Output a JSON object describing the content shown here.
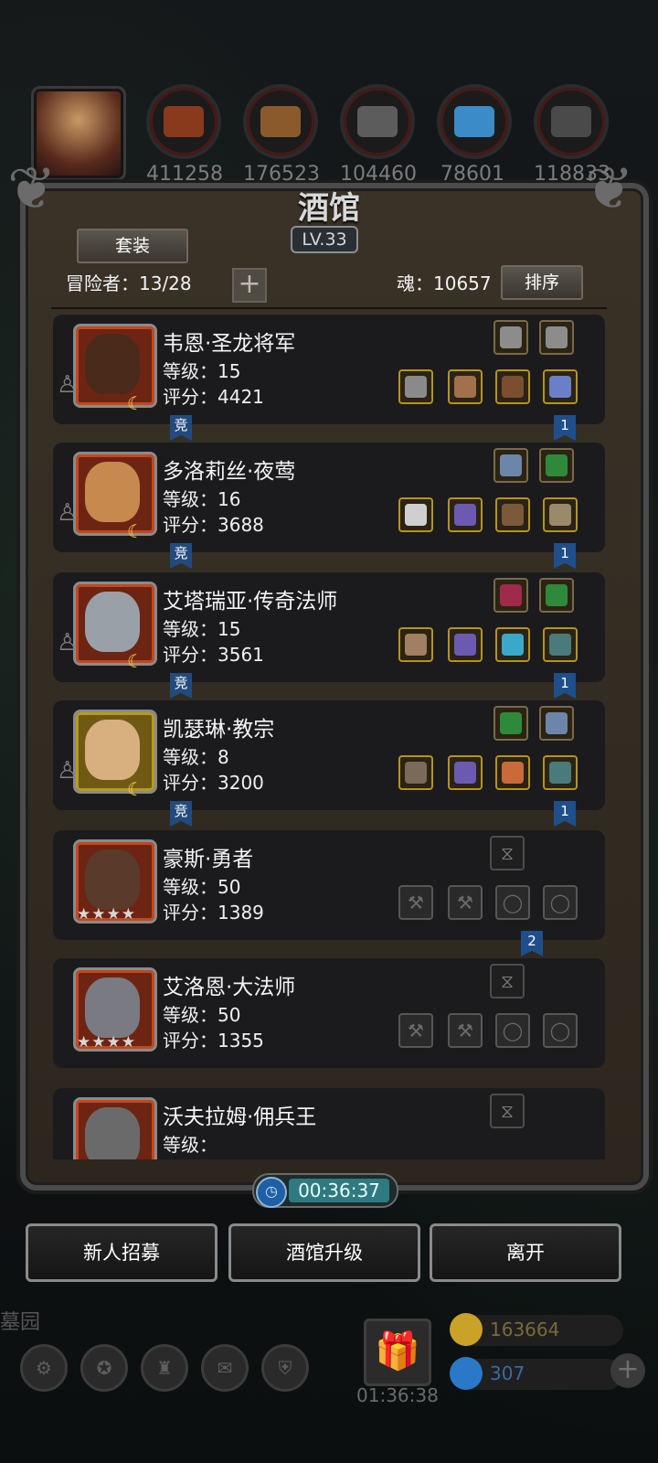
{
  "resources": [
    {
      "name": "meat",
      "value": "411258",
      "color": "#8a3a1c"
    },
    {
      "name": "wood",
      "value": "176523",
      "color": "#8b5a2b"
    },
    {
      "name": "stone",
      "value": "104460",
      "color": "#5c5c5c"
    },
    {
      "name": "crystal",
      "value": "78601",
      "color": "#3a8bc8"
    },
    {
      "name": "iron",
      "value": "118833",
      "color": "#4a4a4a"
    }
  ],
  "tavern": {
    "title": "酒馆",
    "level": "LV.33",
    "set_button": "套装",
    "adventurers_label": "冒险者：13/28",
    "soul_label": "魂：10657",
    "sort_button": "排序"
  },
  "heroes": [
    {
      "name": "韦恩·圣龙将军",
      "level": "等级：15",
      "score": "评分：4421",
      "frame": "red",
      "face": "#4a2a1a",
      "badge": "moon",
      "arena": "竞",
      "tag": "1",
      "top_slots": [
        "#8c8c8c",
        "#8c8c8c"
      ],
      "bottom_slots": [
        "#8a8a8a",
        "#a0714a",
        "#7a4e2e",
        "#6a7fc8"
      ]
    },
    {
      "name": "多洛莉丝·夜莺",
      "level": "等级：16",
      "score": "评分：3688",
      "frame": "red",
      "face": "#c8894f",
      "badge": "moon",
      "arena": "竞",
      "tag": "1",
      "top_slots": [
        "#6b86a8",
        "#2e8a3a"
      ],
      "bottom_slots": [
        "#cfcfcf",
        "#6b5ab0",
        "#7a5a3a",
        "#9a8a6a"
      ]
    },
    {
      "name": "艾塔瑞亚·传奇法师",
      "level": "等级：15",
      "score": "评分：3561",
      "frame": "red",
      "face": "#9aa0a8",
      "badge": "moon",
      "arena": "竞",
      "tag": "1",
      "top_slots": [
        "#a02a4a",
        "#2e8a3a"
      ],
      "bottom_slots": [
        "#a08060",
        "#6b5ab0",
        "#3aa8c8",
        "#4a7a7a"
      ]
    },
    {
      "name": "凯瑟琳·教宗",
      "level": "等级：8",
      "score": "评分：3200",
      "frame": "gold",
      "face": "#d8b080",
      "badge": "moon",
      "arena": "竞",
      "tag": "1",
      "top_slots": [
        "#2e8a3a",
        "#6b86a8"
      ],
      "bottom_slots": [
        "#7a6a5a",
        "#6b5ab0",
        "#c86a3a",
        "#4a7a7a"
      ]
    },
    {
      "name": "豪斯·勇者",
      "level": "等级：50",
      "score": "评分：1389",
      "frame": "red",
      "face": "#5a3a2a",
      "badge": "stars",
      "stars": "★★★★",
      "tag": "2",
      "top_slots": [
        "empty"
      ],
      "bottom_slots": [
        "dim",
        "dim",
        "dim",
        "dim"
      ]
    },
    {
      "name": "艾洛恩·大法师",
      "level": "等级：50",
      "score": "评分：1355",
      "frame": "red",
      "face": "#7a7a82",
      "badge": "stars",
      "stars": "★★★★",
      "top_slots": [
        "empty"
      ],
      "bottom_slots": [
        "dim",
        "dim",
        "dim",
        "dim"
      ]
    },
    {
      "name": "沃夫拉姆·佣兵王",
      "level": "等级：",
      "score": "",
      "frame": "red",
      "face": "#6a6a6a",
      "badge": "none",
      "top_slots": [
        "empty"
      ],
      "bottom_slots": []
    }
  ],
  "timer": "00:36:37",
  "buttons": {
    "recruit": "新人招募",
    "upgrade": "酒馆升级",
    "leave": "离开"
  },
  "dock": {
    "garden": "墓园",
    "gift_timer": "01:36:38"
  },
  "currency": {
    "gold": "163664",
    "gold_color": "#c9a227",
    "gems": "307",
    "gem_color": "#2a78c8"
  }
}
